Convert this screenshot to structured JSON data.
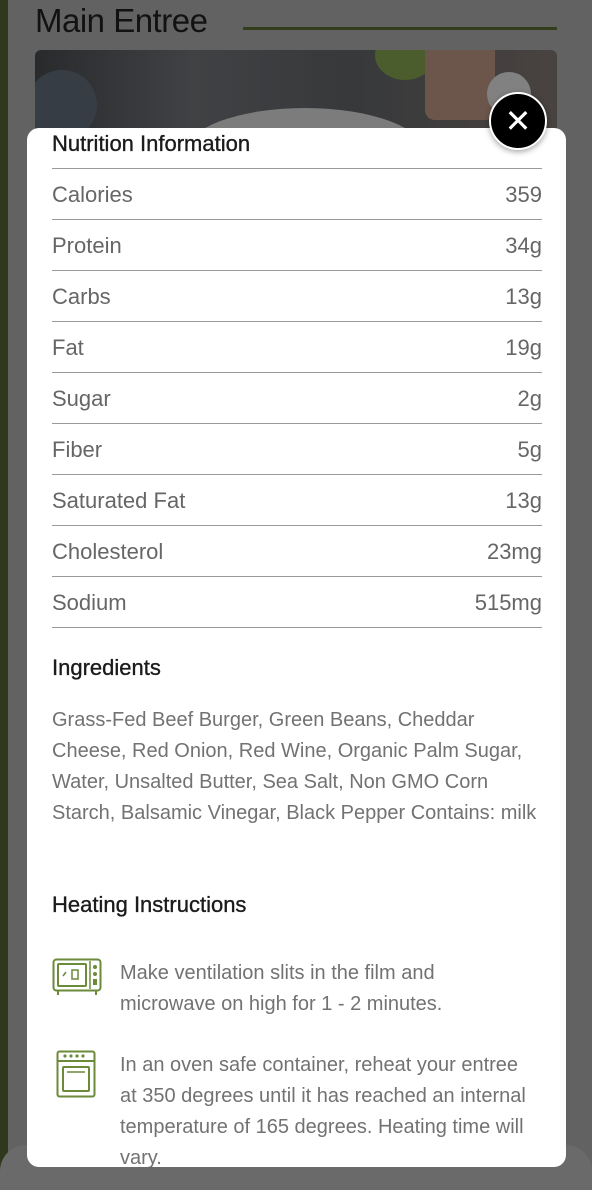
{
  "background": {
    "title": "Main Entree"
  },
  "modal": {
    "close_icon": "✕",
    "nutrition": {
      "title": "Nutrition Information",
      "rows": [
        {
          "label": "Calories",
          "value": "359"
        },
        {
          "label": "Protein",
          "value": "34g"
        },
        {
          "label": "Carbs",
          "value": "13g"
        },
        {
          "label": "Fat",
          "value": "19g"
        },
        {
          "label": "Sugar",
          "value": "2g"
        },
        {
          "label": "Fiber",
          "value": "5g"
        },
        {
          "label": "Saturated Fat",
          "value": "13g"
        },
        {
          "label": "Cholesterol",
          "value": "23mg"
        },
        {
          "label": "Sodium",
          "value": "515mg"
        }
      ]
    },
    "ingredients": {
      "title": "Ingredients",
      "text": "Grass-Fed Beef Burger, Green Beans, Cheddar Cheese, Red Onion, Red Wine, Organic Palm Sugar, Water, Unsalted Butter, Sea Salt, Non GMO Corn Starch, Balsamic Vinegar, Black Pepper Contains: milk"
    },
    "heating": {
      "title": "Heating Instructions",
      "items": [
        {
          "icon": "microwave-icon",
          "text": "Make ventilation slits in the film and microwave on high for 1 - 2 minutes."
        },
        {
          "icon": "oven-icon",
          "text": "In an oven safe container, reheat your entree at 350 degrees until it has reached an internal temperature of 165 degrees. Heating time will vary."
        }
      ]
    }
  },
  "colors": {
    "accent_green": "#6b8a3a",
    "dark_green": "#4f5e2f"
  }
}
